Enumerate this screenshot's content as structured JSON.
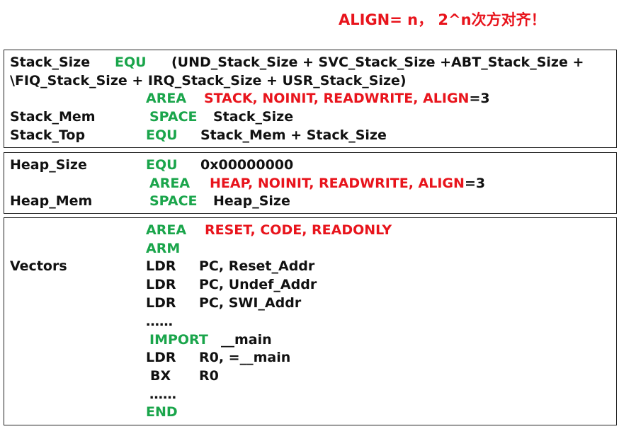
{
  "note": {
    "latin": "ALIGN= n，  2^n",
    "cjk": "次方对齐！"
  },
  "stack_box": {
    "line1": {
      "label": "Stack_Size",
      "directive": "EQU",
      "expr": "(UND_Stack_Size + SVC_Stack_Size +ABT_Stack_Size +"
    },
    "line2": {
      "expr": "\\FIQ_Stack_Size + IRQ_Stack_Size + USR_Stack_Size)"
    },
    "line3": {
      "directive": "AREA",
      "args": "STACK, NOINIT, READWRITE, ALIGN",
      "suffix": "=3"
    },
    "line4": {
      "label": "Stack_Mem",
      "directive": "SPACE",
      "expr": "Stack_Size"
    },
    "line5": {
      "label": "Stack_Top",
      "directive": "EQU",
      "expr": "Stack_Mem + Stack_Size"
    }
  },
  "heap_box": {
    "line1": {
      "label": "Heap_Size",
      "directive": "EQU",
      "expr": "0x00000000"
    },
    "line2": {
      "directive": "AREA",
      "args": "HEAP, NOINIT, READWRITE, ALIGN",
      "suffix": "=3"
    },
    "line3": {
      "label": "Heap_Mem",
      "directive": "SPACE",
      "expr": "Heap_Size"
    }
  },
  "vectors_box": {
    "line1": {
      "directive": "AREA",
      "args": "RESET, CODE, READONLY"
    },
    "line2": {
      "directive": "ARM"
    },
    "line3": {
      "label": "Vectors",
      "op": "LDR",
      "operands": "PC, Reset_Addr"
    },
    "line4": {
      "op": "LDR",
      "operands": "PC, Undef_Addr"
    },
    "line5": {
      "op": "LDR",
      "operands": "PC, SWI_Addr"
    },
    "line6": {
      "ellipsis": "……"
    },
    "line7": {
      "directive": "IMPORT",
      "operands": "__main"
    },
    "line8": {
      "op": "LDR",
      "operands": "R0, =__main"
    },
    "line9": {
      "op": "BX",
      "operands": "R0"
    },
    "line10": {
      "ellipsis": "……"
    },
    "line11": {
      "directive": "END"
    }
  }
}
